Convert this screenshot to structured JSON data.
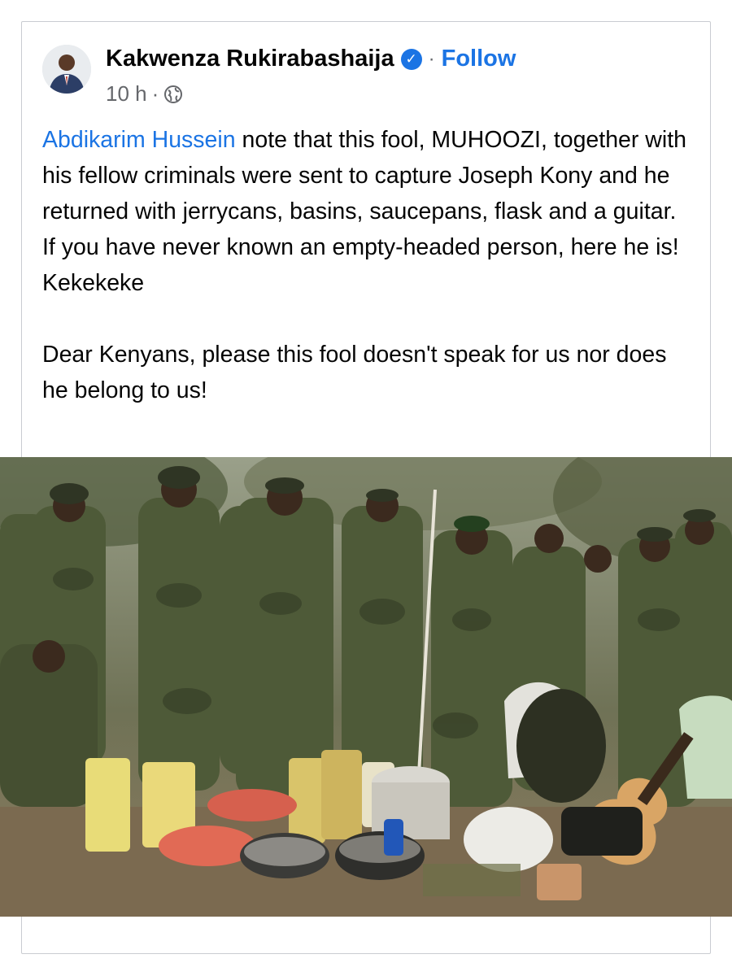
{
  "post": {
    "author_name": "Kakwenza Rukirabashaija",
    "separator": "·",
    "follow_label": "Follow",
    "time": "10 h",
    "time_separator": "·",
    "icons": {
      "verified": "verified-badge-icon",
      "audience": "globe-icon"
    },
    "colors": {
      "link": "#1b74e4",
      "secondary_text": "#65676b"
    },
    "mention": "Abdikarim Hussein",
    "paragraph1_rest": " note that this fool, MUHOOZI, together with his fellow criminals were sent to capture Joseph Kony and he returned with jerrycans, basins, saucepans, flask and a guitar. If you have never known an empty-headed person, here he is! Kekekeke",
    "paragraph2": "Dear Kenyans, please this fool doesn't speak for us nor does he belong to us!"
  }
}
